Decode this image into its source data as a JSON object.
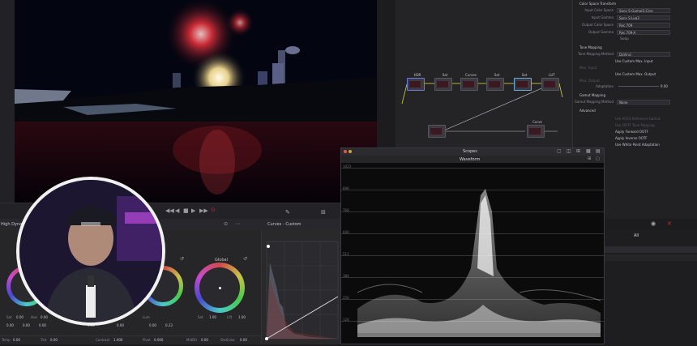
{
  "transport": {
    "buttons": [
      "◀◀",
      "◀",
      "■",
      "▶",
      "▶▶",
      "⊙"
    ]
  },
  "color_toolbar": {
    "left_label": "High Dyna",
    "panel_title": "Curves - Custom"
  },
  "wheels": {
    "global_label": "Global",
    "row1": [
      "Sat",
      "0.00",
      "Hue",
      "0.00",
      "Lum",
      "Lift",
      "0.00",
      "0.00",
      "0.00",
      "0.00",
      "Off",
      "0.00",
      "0.00",
      "0.23",
      "Sat",
      "1.00",
      "Lift",
      "1.00"
    ],
    "row2": [
      "Temp",
      "0.00",
      "Tint",
      "0.00",
      "Contrast",
      "1.000",
      "Pivot",
      "0.000",
      "MidDtl",
      "0.00",
      "ShdColor",
      "0.00"
    ]
  },
  "node_editor": {
    "nodes": [
      {
        "label": "HDR"
      },
      {
        "label": "Sat"
      },
      {
        "label": "Curves"
      },
      {
        "label": "Sat"
      },
      {
        "label": "Sat"
      },
      {
        "label": "LUT"
      },
      {
        "label": "Curve"
      }
    ]
  },
  "inspector": {
    "section_color_space": "Color Space Transform",
    "input_color_space_label": "Input Color Space",
    "input_color_space": "Sony S-Gamut3.Cine",
    "input_gamma_label": "Input Gamma",
    "input_gamma": "Sony S-Log3",
    "output_color_space_label": "Output Color Space",
    "output_color_space": "Rec.709",
    "output_gamma_label": "Output Gamma",
    "output_gamma": "Rec.709-A",
    "swap_label": "Swap",
    "section_tone": "Tone Mapping",
    "tone_method_label": "Tone Mapping Method",
    "tone_method": "DaVinci",
    "use_custom_max_input": "Use Custom Max. Input",
    "max_input_label": "Max. Input",
    "use_custom_max_output": "Use Custom Max. Output",
    "max_output_label": "Max. Output",
    "adaptation_label": "Adaptation",
    "adaptation_value": "9.00",
    "section_gamut": "Gamut Mapping",
    "gamut_method_label": "Gamut Mapping Method",
    "gamut_method": "None",
    "section_advanced": "Advanced",
    "apply_forward_ootf": "Apply Forward OOTF",
    "apply_inverse_ootf": "Apply Inverse OOTF",
    "use_white_point": "Use White Point Adaptation",
    "dim_option_1": "Use ACES Reference Gamut",
    "dim_option_2": "Use OOTF Tone Mapping",
    "lower_all": "All"
  },
  "scopes": {
    "window_title": "Scopes",
    "scope_type": "Waveform",
    "y_labels": [
      "1023",
      "896",
      "768",
      "640",
      "512",
      "384",
      "256",
      "128"
    ]
  },
  "colors": {
    "accent_red": "#c2303a",
    "node_link": "#d8d82a"
  }
}
